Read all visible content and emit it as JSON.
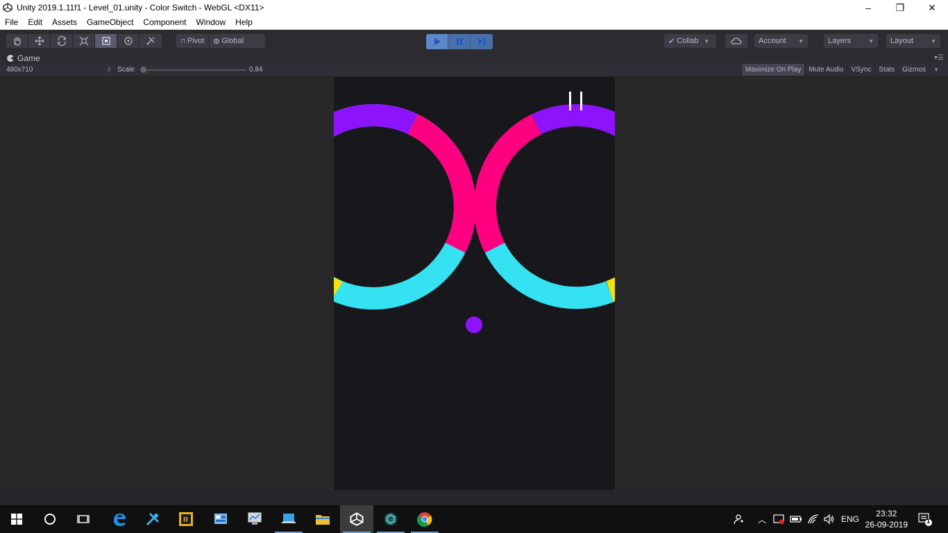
{
  "window": {
    "title": "Unity 2019.1.11f1 - Level_01.unity - Color Switch - WebGL <DX11>",
    "minimize": "–",
    "maximize": "❐",
    "close": "✕"
  },
  "menu": [
    "File",
    "Edit",
    "Assets",
    "GameObject",
    "Component",
    "Window",
    "Help"
  ],
  "toolbar": {
    "pivot_label": "Pivot",
    "global_label": "Global",
    "collab_label": "Collab",
    "account_label": "Account",
    "layers_label": "Layers",
    "layout_label": "Layout",
    "play_state": "playing"
  },
  "game_tab": {
    "label": "Game",
    "resolution": "480x710",
    "scale_label": "Scale",
    "scale_value": "0.84",
    "options": [
      "Maximize On Play",
      "Mute Audio",
      "VSync",
      "Stats",
      "Gizmos"
    ]
  },
  "game": {
    "pause_icon": "pause-icon",
    "colors": {
      "purple": "#8c13fb",
      "pink": "#ff0080",
      "cyan": "#35e2f2",
      "yellow": "#f6df0e",
      "background": "#18181c"
    }
  },
  "taskbar": {
    "language": "ENG",
    "time": "23:32",
    "date": "26-09-2019",
    "notification_count": "1"
  },
  "colors": {
    "editor_dark": "#2b2b30",
    "play_blue": "#4a6fa8"
  }
}
